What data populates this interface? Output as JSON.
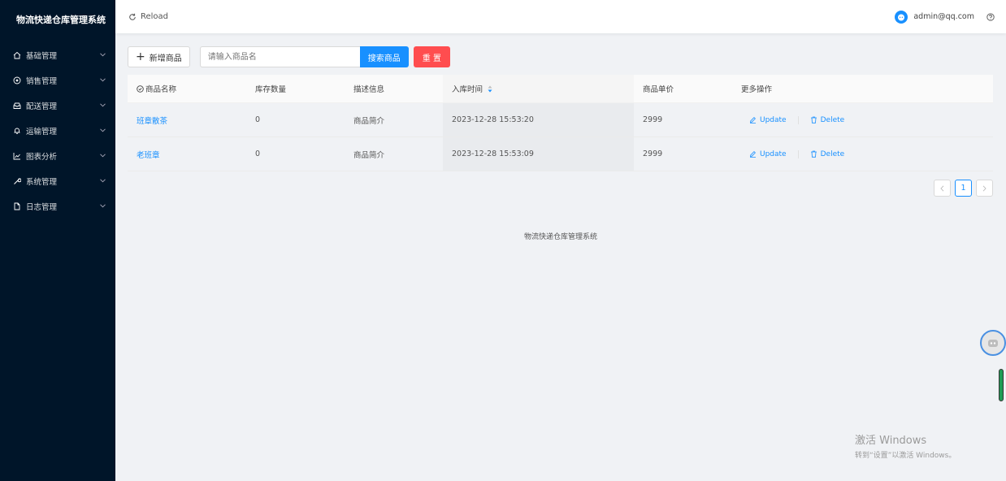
{
  "sidebar": {
    "title": "物流快递仓库管理系统",
    "items": [
      {
        "label": "基础管理",
        "icon": "home-icon"
      },
      {
        "label": "销售管理",
        "icon": "circle-dollar-icon"
      },
      {
        "label": "配送管理",
        "icon": "inbox-icon"
      },
      {
        "label": "运输管理",
        "icon": "bell-icon"
      },
      {
        "label": "图表分析",
        "icon": "line-chart-icon"
      },
      {
        "label": "系统管理",
        "icon": "tool-icon"
      },
      {
        "label": "日志管理",
        "icon": "file-icon"
      }
    ]
  },
  "header": {
    "reload_label": "Reload",
    "user": "admin@qq.com"
  },
  "toolbar": {
    "add_label": "新增商品",
    "search_placeholder": "请输入商品名",
    "search_label": "搜索商品",
    "reset_label": "重 置"
  },
  "table": {
    "columns": [
      "商品名称",
      "库存数量",
      "描述信息",
      "入库时间",
      "商品单价",
      "更多操作"
    ],
    "rows": [
      {
        "name": "班章散茶",
        "stock": "0",
        "desc": "商品简介",
        "time": "2023-12-28 15:53:20",
        "price": "2999",
        "update": "Update",
        "delete": "Delete"
      },
      {
        "name": "老班章",
        "stock": "0",
        "desc": "商品简介",
        "time": "2023-12-28 15:53:09",
        "price": "2999",
        "update": "Update",
        "delete": "Delete"
      }
    ]
  },
  "pagination": {
    "current": "1"
  },
  "footer": "物流快递仓库管理系统",
  "watermark": {
    "line1": "激活 Windows",
    "line2": "转到“设置”以激活 Windows。"
  },
  "colors": {
    "sidebar_bg": "#001529",
    "primary": "#1890ff",
    "danger": "#ff4d4f"
  }
}
